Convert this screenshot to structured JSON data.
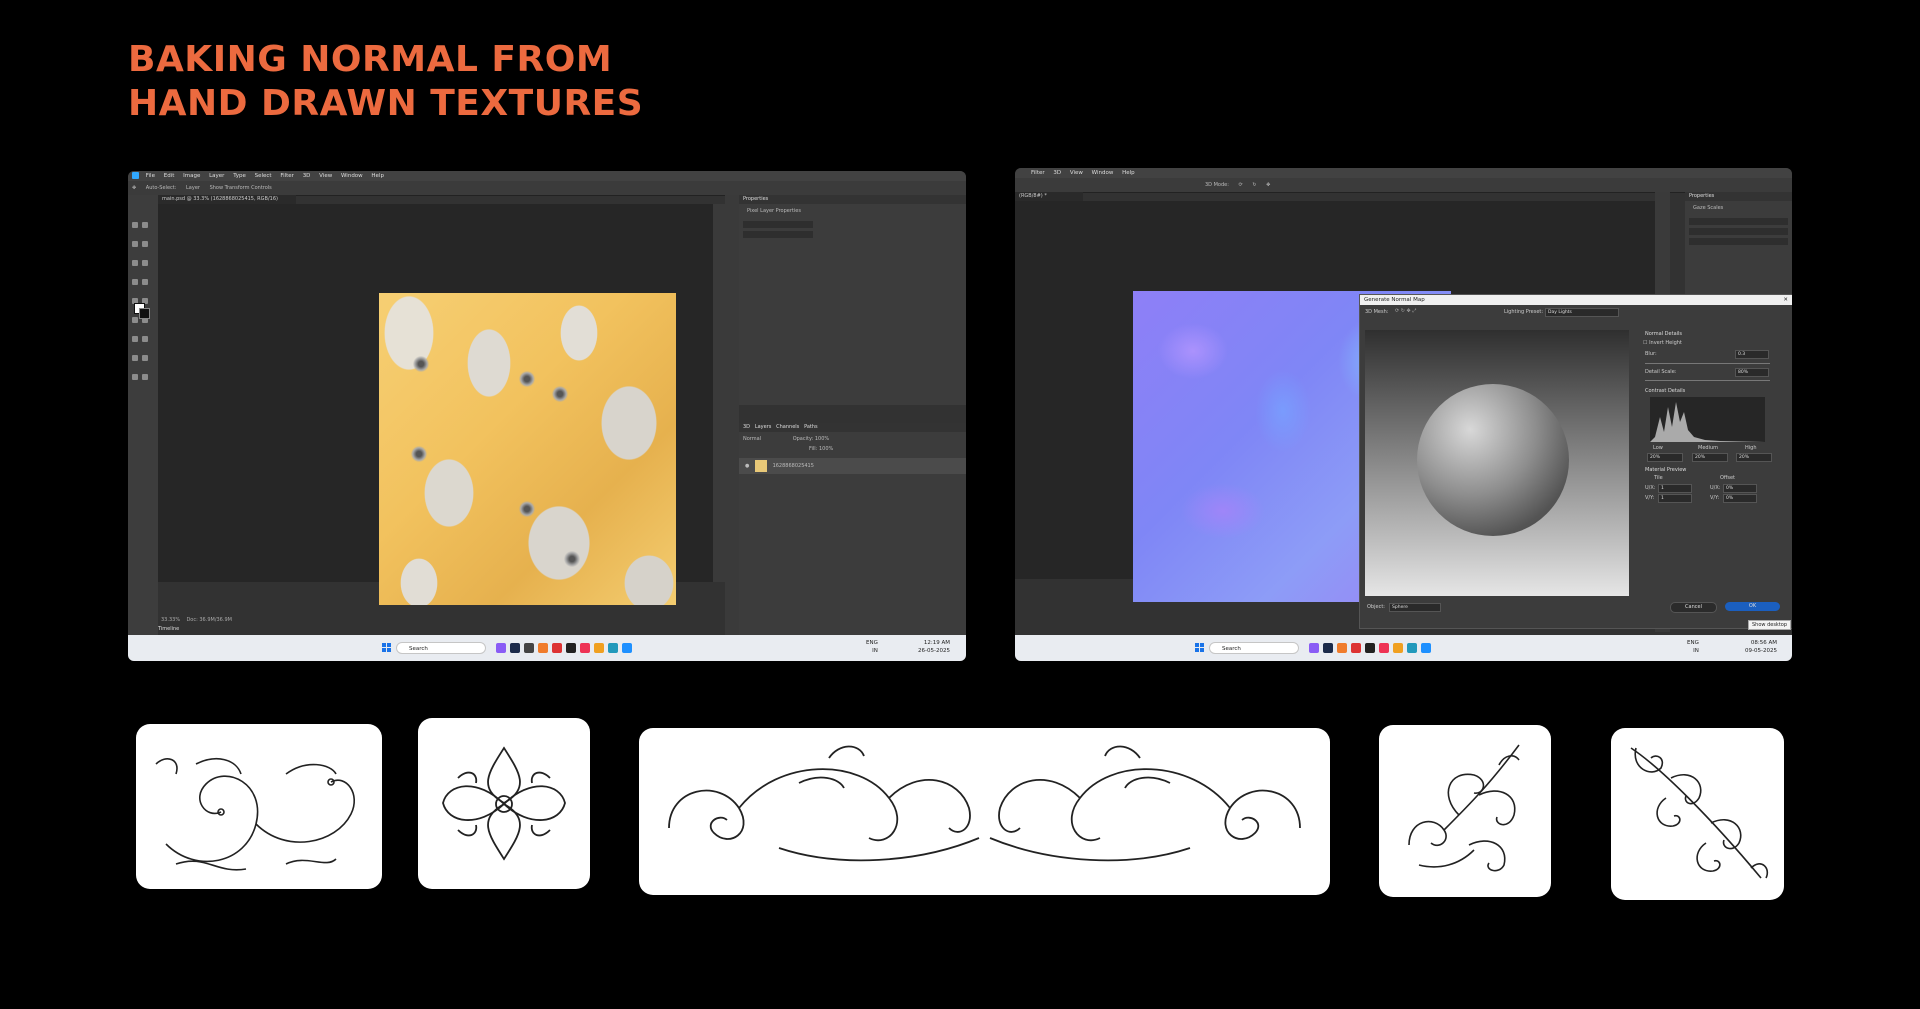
{
  "title": {
    "line1": "BAKING NORMAL FROM",
    "line2": "HAND DRAWN TEXTURES"
  },
  "shot1": {
    "menu": [
      "File",
      "Edit",
      "Image",
      "Layer",
      "Type",
      "Select",
      "Filter",
      "3D",
      "View",
      "Window",
      "Help"
    ],
    "options": [
      "Auto-Select:",
      "Layer",
      "Show Transform Controls"
    ],
    "doc_tab": "main.psd @ 33.3% (1628868025415, RGB/16)",
    "properties_title": "Properties",
    "properties_sub": "Pixel Layer Properties",
    "layers_tabs": [
      "3D",
      "Layers",
      "Channels",
      "Paths"
    ],
    "blend_mode": "Normal",
    "opacity_label": "Opacity:",
    "opacity": "100%",
    "fill_label": "Fill:",
    "fill": "100%",
    "layer_name": "1628868025415",
    "status_zoom": "33.33%",
    "status_doc": "Doc: 36.9M/36.9M",
    "timeline": "Timeline",
    "taskbar_search": "Search",
    "tray_lang": "ENG",
    "tray_region": "IN",
    "clock_time": "12:19 AM",
    "clock_date": "26-05-2025"
  },
  "shot2": {
    "menu": [
      "Filter",
      "3D",
      "View",
      "Window",
      "Help"
    ],
    "mode_3d": "3D Mode:",
    "doc_tab": "(RGB/8#) *",
    "properties_title": "Properties",
    "properties_sub": "Gaze Scales",
    "dialog": {
      "title": "Generate Normal Map",
      "close": "✕",
      "mesh_label": "3D Mesh:",
      "lighting_label": "Lighting Preset:",
      "lighting_value": "Day Lights",
      "normal_details": "Normal Details",
      "invert_height": "Invert Height",
      "blur_label": "Blur:",
      "blur_value": "0.3",
      "detail_scale_label": "Detail Scale:",
      "detail_scale_value": "80%",
      "contrast_details": "Contrast Details",
      "low": "Low",
      "medium": "Medium",
      "high": "High",
      "low_value": "20%",
      "medium_value": "20%",
      "high_value": "20%",
      "material_preview": "Material Preview",
      "tile": "Tile",
      "offset": "Offset",
      "uv_x_label": "U/X:",
      "uv_x_value": "1",
      "uv_y_label": "V/Y:",
      "uv_y_value": "1",
      "off_x_label": "U/X:",
      "off_x_value": "0%",
      "off_y_label": "V/Y:",
      "off_y_value": "0%",
      "object_label": "Object:",
      "object_value": "Sphere",
      "cancel": "Cancel",
      "ok": "OK"
    },
    "show_desktop": "Show desktop",
    "taskbar_search": "Search",
    "tray_lang": "ENG",
    "tray_region": "IN",
    "clock_time": "08:56 AM",
    "clock_date": "09-05-2025"
  },
  "cards": [
    "ornament-vine-left",
    "ornament-fleur-symmetric",
    "ornament-scroll-banner",
    "ornament-flourish-spray",
    "ornament-diagonal-acanthus"
  ],
  "colors": {
    "accent": "#ec6a3f",
    "background": "#000000",
    "ps_blue": "#31a8ff"
  }
}
